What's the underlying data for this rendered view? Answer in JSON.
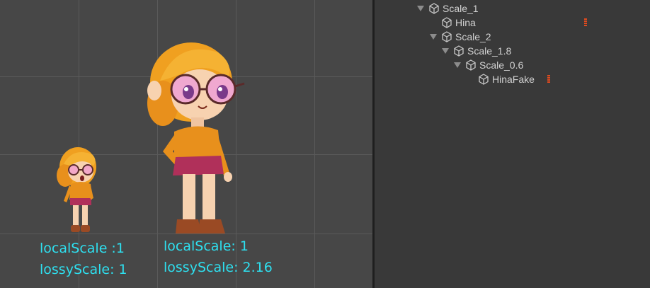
{
  "scene": {
    "small_character": {
      "local_scale_text": "localScale :1",
      "lossy_scale_text": "lossyScale: 1"
    },
    "large_character": {
      "local_scale_text": "localScale: 1",
      "lossy_scale_text": "lossyScale: 2.16"
    },
    "caption_color": "#2ee0f0"
  },
  "hierarchy": {
    "items": [
      {
        "label": "Scale_1",
        "foldout": true
      },
      {
        "label": "Hina",
        "foldout": false,
        "icon_after": "warning-icon"
      },
      {
        "label": "Scale_2",
        "foldout": true
      },
      {
        "label": "Scale_1.8",
        "foldout": true
      },
      {
        "label": "Scale_0.6",
        "foldout": true
      },
      {
        "label": "HinaFake",
        "foldout": false,
        "icon_after": "warning-icon"
      }
    ]
  }
}
